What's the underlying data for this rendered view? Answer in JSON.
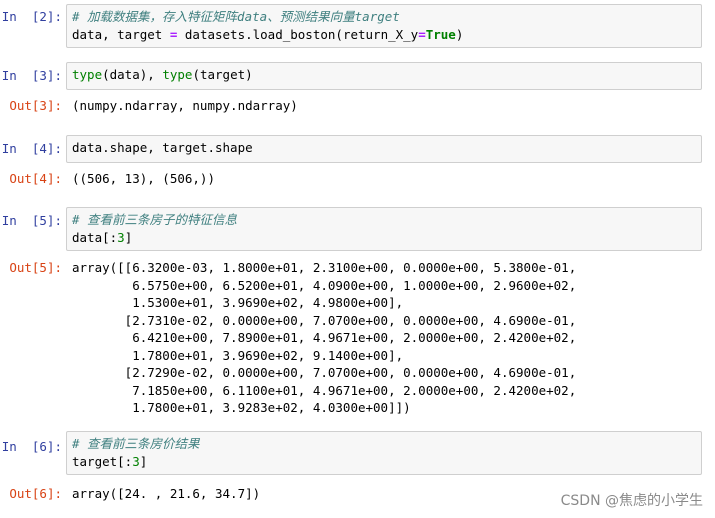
{
  "cells": [
    {
      "in_prompt": "In  [2]:",
      "code": {
        "l1_comment": "# 加载数据集，存入特征矩阵data、预测结果向量target",
        "l2_a": "data, target ",
        "l2_eq": "=",
        "l2_b": " datasets.load_boston(return_X_y",
        "l2_eq2": "=",
        "l2_true": "True",
        "l2_c": ")"
      }
    },
    {
      "in_prompt": "In  [3]:",
      "code": {
        "t1": "type",
        "a1": "(data), ",
        "t2": "type",
        "a2": "(target)"
      },
      "out_prompt": "Out[3]:",
      "output": [
        "(numpy.ndarray, numpy.ndarray)"
      ]
    },
    {
      "in_prompt": "In  [4]:",
      "code": {
        "line": "data.shape, target.shape"
      },
      "out_prompt": "Out[4]:",
      "output": [
        "((506, 13), (506,))"
      ]
    },
    {
      "in_prompt": "In  [5]:",
      "code": {
        "l1_comment": "# 查看前三条房子的特征信息",
        "l2_a": "data[:",
        "l2_num": "3",
        "l2_b": "]"
      },
      "out_prompt": "Out[5]:",
      "output": [
        "array([[6.3200e-03, 1.8000e+01, 2.3100e+00, 0.0000e+00, 5.3800e-01,",
        "        6.5750e+00, 6.5200e+01, 4.0900e+00, 1.0000e+00, 2.9600e+02,",
        "        1.5300e+01, 3.9690e+02, 4.9800e+00],",
        "       [2.7310e-02, 0.0000e+00, 7.0700e+00, 0.0000e+00, 4.6900e-01,",
        "        6.4210e+00, 7.8900e+01, 4.9671e+00, 2.0000e+00, 2.4200e+02,",
        "        1.7800e+01, 3.9690e+02, 9.1400e+00],",
        "       [2.7290e-02, 0.0000e+00, 7.0700e+00, 0.0000e+00, 4.6900e-01,",
        "        7.1850e+00, 6.1100e+01, 4.9671e+00, 2.0000e+00, 2.4200e+02,",
        "        1.7800e+01, 3.9283e+02, 4.0300e+00]])"
      ]
    },
    {
      "in_prompt": "In  [6]:",
      "code": {
        "l1_comment": "# 查看前三条房价结果",
        "l2_a": "target[:",
        "l2_num": "3",
        "l2_b": "]"
      },
      "out_prompt": "Out[6]:",
      "output": [
        "array([24. , 21.6, 34.7])"
      ]
    }
  ],
  "watermark": "CSDN @焦虑的小学生"
}
